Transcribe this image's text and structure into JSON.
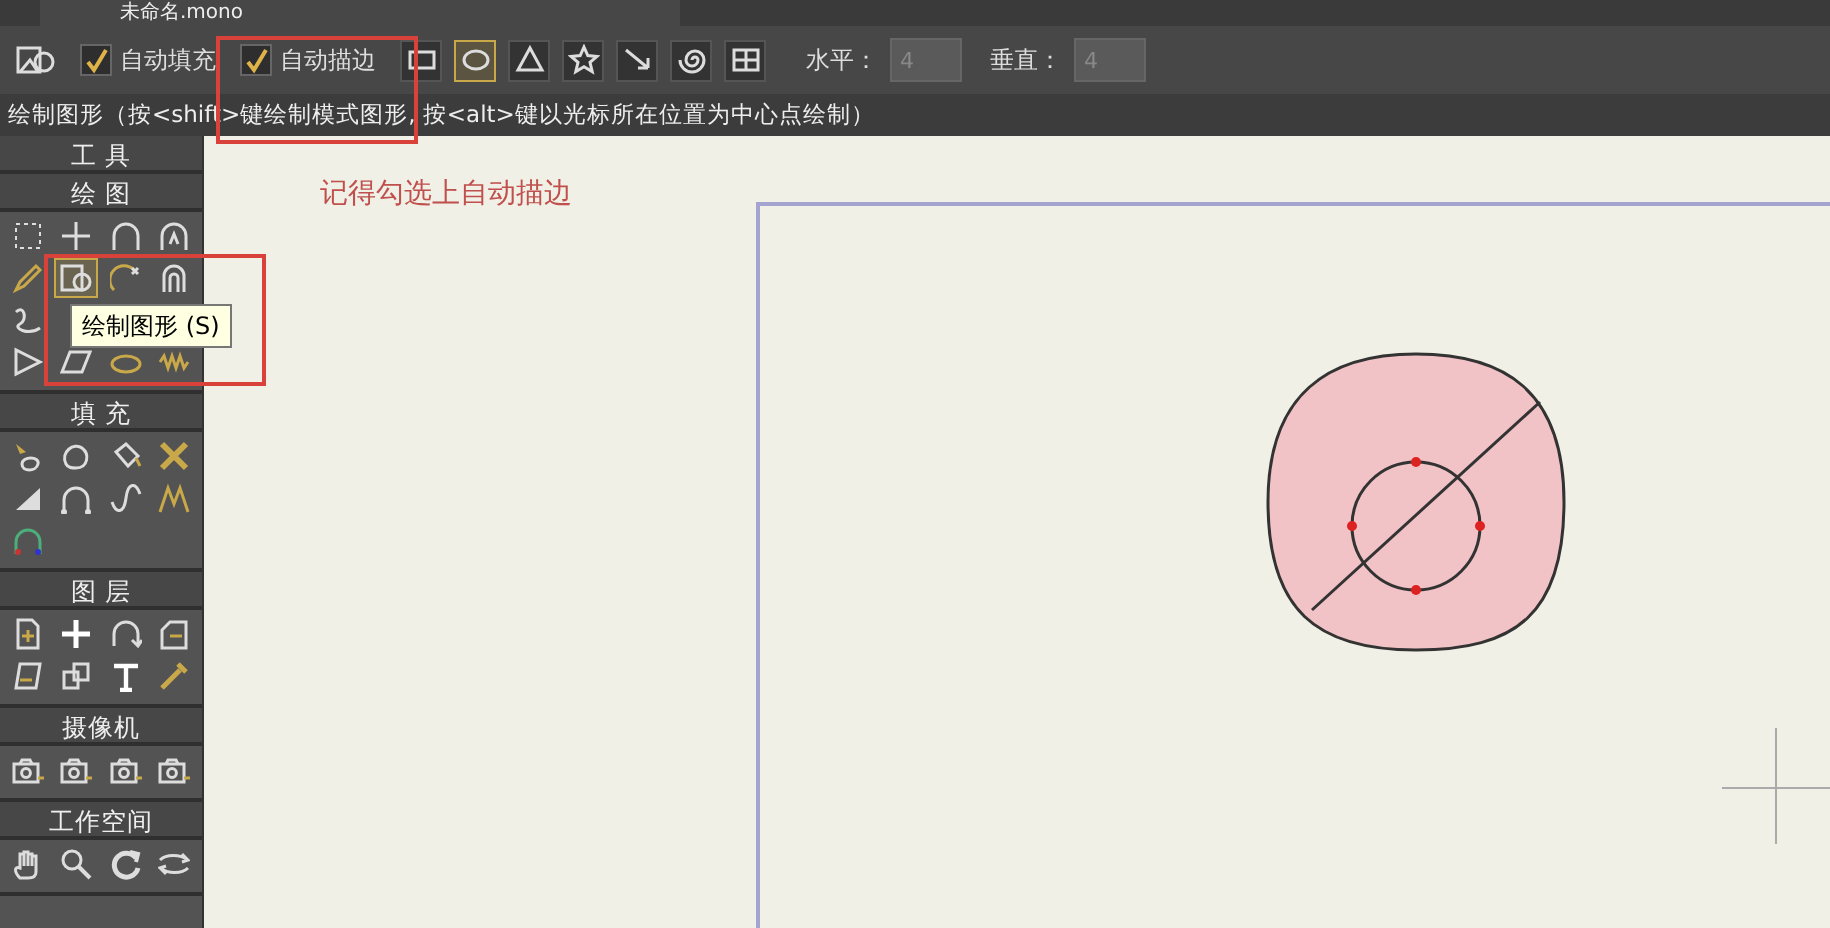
{
  "document_tab": {
    "title": "未命名.mono"
  },
  "toolbar": {
    "options": [
      {
        "label": "自动填充",
        "checked": true
      },
      {
        "label": "自动描边",
        "checked": true
      }
    ],
    "shapes": [
      {
        "kind": "rectangle",
        "selected": false
      },
      {
        "kind": "ellipse",
        "selected": true
      },
      {
        "kind": "triangle",
        "selected": false
      },
      {
        "kind": "star",
        "selected": false
      },
      {
        "kind": "arrow",
        "selected": false
      },
      {
        "kind": "spiral",
        "selected": false
      },
      {
        "kind": "grid",
        "selected": false
      }
    ],
    "fields": [
      {
        "label": "水平：",
        "value": "4",
        "disabled": true
      },
      {
        "label": "垂直：",
        "value": "4",
        "disabled": true
      }
    ]
  },
  "status_hint": "绘制图形（按<shift>键绘制模式图形, 按<alt>键以光标所在位置为中心点绘制）",
  "tool_panel": {
    "title": "工 具",
    "sections": [
      {
        "title": "绘 图",
        "rows": [
          [
            {
              "selected": false
            },
            {
              "selected": false
            },
            {
              "selected": false
            },
            {
              "selected": false
            }
          ],
          [
            {
              "selected": false
            },
            {
              "selected": true
            },
            {
              "selected": false
            },
            {
              "selected": false
            }
          ],
          [
            {
              "selected": false
            }
          ],
          [
            {
              "selected": false
            },
            {
              "selected": false
            },
            {
              "selected": false
            },
            {
              "selected": false
            }
          ]
        ]
      },
      {
        "title": "填 充",
        "rows": [
          [
            {
              "selected": false
            },
            {
              "selected": false
            },
            {
              "selected": false
            },
            {
              "selected": false
            }
          ],
          [
            {
              "selected": false
            },
            {
              "selected": false
            },
            {
              "selected": false
            },
            {
              "selected": false
            }
          ],
          [
            {
              "selected": false
            }
          ]
        ]
      },
      {
        "title": "图 层",
        "rows": [
          [
            {
              "selected": false
            },
            {
              "selected": false
            },
            {
              "selected": false
            },
            {
              "selected": false
            }
          ],
          [
            {
              "selected": false
            },
            {
              "selected": false
            },
            {
              "selected": false
            },
            {
              "selected": false
            }
          ]
        ]
      },
      {
        "title": "摄像机",
        "rows": [
          [
            {
              "selected": false
            },
            {
              "selected": false
            },
            {
              "selected": false
            },
            {
              "selected": false
            }
          ]
        ]
      },
      {
        "title": "工作空间",
        "rows": [
          [
            {
              "selected": false
            },
            {
              "selected": false
            },
            {
              "selected": false
            },
            {
              "selected": false
            }
          ]
        ]
      }
    ]
  },
  "tooltip": "绘制图形 (S)",
  "annotation": "记得勾选上自动描边"
}
